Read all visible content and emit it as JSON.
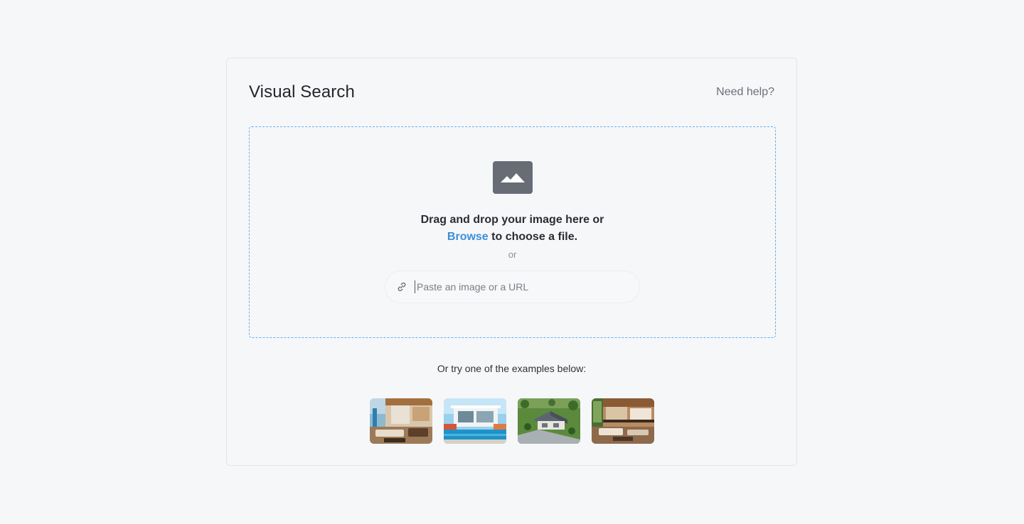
{
  "header": {
    "title": "Visual Search",
    "help_link": "Need help?"
  },
  "dropzone": {
    "icon": "image-icon",
    "text_line1": "Drag and drop your image here or",
    "browse_label": "Browse",
    "text_line2_rest": " to choose a file.",
    "or_label": "or"
  },
  "url_input": {
    "icon": "link-icon",
    "placeholder": "Paste an image or a URL",
    "value": ""
  },
  "examples": {
    "label": "Or try one of the examples below:",
    "thumbnails": [
      "living-room-thumbnail",
      "pool-villa-thumbnail",
      "aerial-house-thumbnail",
      "interior-loft-thumbnail"
    ]
  },
  "colors": {
    "background": "#f6f7f9",
    "accent": "#3b8fd9",
    "dropzone_border": "#62b0ef",
    "icon_gray": "#676c75"
  }
}
